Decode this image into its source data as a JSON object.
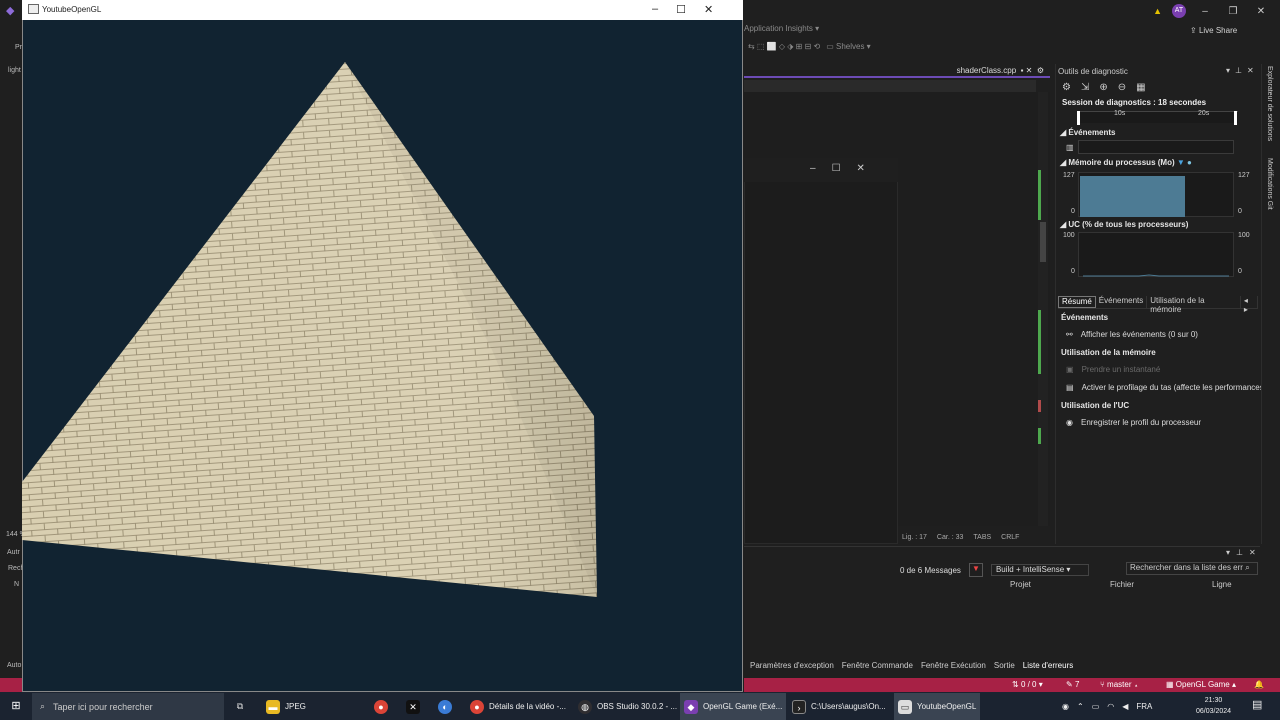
{
  "colors": {
    "gl_bg": "#112331",
    "accent": "#6c4bb5",
    "vs_status": "#a72145",
    "mem_fill": "#4d7b94"
  },
  "vs": {
    "user_initials": "AT",
    "toolbar_app_insights": "Application Insights",
    "toolbar_shelves": "Shelves",
    "live_share": "Live Share",
    "editor_tab": "shaderClass.cpp",
    "status_line": "Lig. : 17",
    "status_col": "Car. : 33",
    "status_tabs": "TABS",
    "status_crlf": "CRLF",
    "left_bits": {
      "pr": "Pr",
      "light": "light",
      "zoom": "144 %",
      "auto": "Autr",
      "rech": "Rech",
      "n": "N",
      "auto2": "Auto",
      "p": "P"
    }
  },
  "diag": {
    "title": "Outils de diagnostic",
    "session": "Session de diagnostics : 18 secondes",
    "tick_10": "10s",
    "tick_20": "20s",
    "events_label": "Événements",
    "mem_label": "Mémoire du processus (Mo)",
    "mem_max": "127",
    "mem_min": "0",
    "mem_fill_fraction": 0.67,
    "cpu_label": "UC (% de tous les processeurs)",
    "cpu_max": "100",
    "cpu_min": "0",
    "tabs": [
      "Résumé",
      "Événements",
      "Utilisation de la mémoire"
    ],
    "sec_events": "Événements",
    "show_events": "Afficher les événements (0 sur 0)",
    "sec_memory": "Utilisation de la mémoire",
    "snapshot": "Prendre un instantané",
    "heap_profiling": "Activer le profilage du tas (affecte les performances",
    "sec_cpu": "Utilisation de l'UC",
    "cpu_profile": "Enregistrer le profil du processeur"
  },
  "side": {
    "solution_explorer": "Explorateur de solutions",
    "git_changes": "Modifications Git"
  },
  "errlist": {
    "messages": "0 de 6 Messages",
    "build_option": "Build + IntelliSense",
    "search_placeholder": "Rechercher dans la liste des err",
    "col_project": "Projet",
    "col_file": "Fichier",
    "col_line": "Ligne"
  },
  "bottom_tabs": [
    "Paramètres d'exception",
    "Fenêtre Commande",
    "Fenêtre Exécution",
    "Sortie",
    "Liste d'erreurs"
  ],
  "statusbar": {
    "errors": "0 / 0",
    "edits": "7",
    "branch": "master",
    "project": "OpenGL Game"
  },
  "gl": {
    "title": "YoutubeOpenGL"
  },
  "taskbar": {
    "search": "Taper ici pour rechercher",
    "apps": [
      {
        "label": "JPEG"
      },
      {
        "label": "Détails de la vidéo -..."
      },
      {
        "label": "OBS Studio 30.0.2 - ..."
      },
      {
        "label": "OpenGL Game (Exé..."
      },
      {
        "label": "C:\\Users\\augus\\On..."
      },
      {
        "label": "YoutubeOpenGL"
      }
    ],
    "lang": "FRA",
    "time": "21:30",
    "date": "06/03/2024"
  }
}
